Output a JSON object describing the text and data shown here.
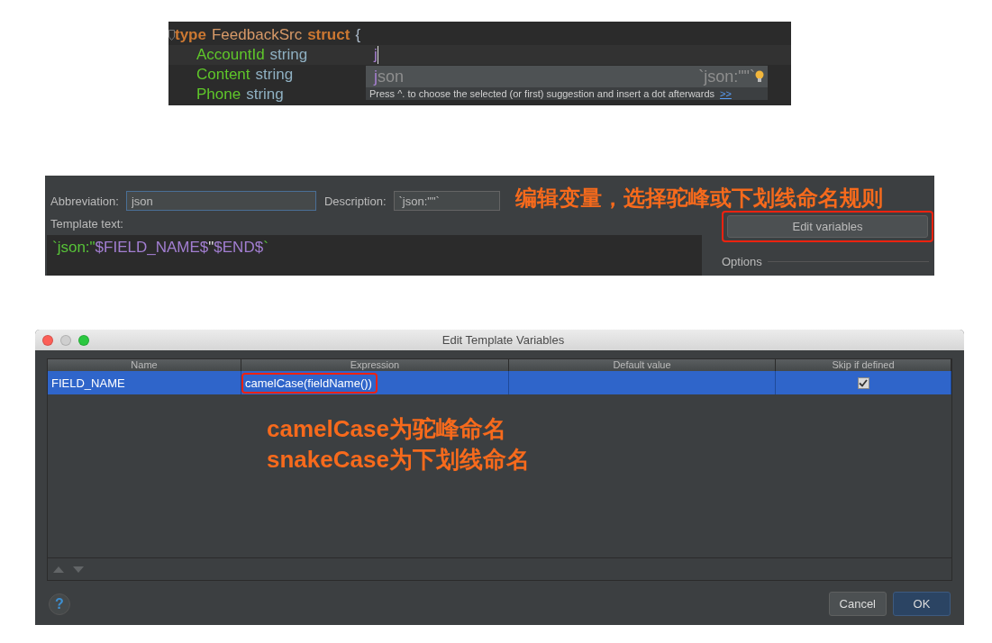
{
  "code_editor": {
    "lines": [
      {
        "highlighted": false,
        "fold": true,
        "tokens": [
          {
            "text": "type",
            "kind": "keyword"
          },
          {
            "text": "FeedbackSrc",
            "kind": "typename"
          },
          {
            "text": "struct",
            "kind": "keyword"
          },
          {
            "text": "{",
            "kind": "plain"
          }
        ]
      },
      {
        "highlighted": true,
        "fold": false,
        "tokens": [
          {
            "text": "AccountId",
            "kind": "field"
          },
          {
            "text": "string",
            "kind": "type"
          }
        ],
        "tail": [
          {
            "text": "j",
            "kind": "typed"
          }
        ]
      },
      {
        "highlighted": false,
        "fold": false,
        "tokens": [
          {
            "text": "Content",
            "kind": "field"
          },
          {
            "text": "string",
            "kind": "type"
          }
        ]
      },
      {
        "highlighted": false,
        "fold": false,
        "tokens": [
          {
            "text": "Phone",
            "kind": "field"
          },
          {
            "text": "string",
            "kind": "type"
          }
        ]
      }
    ],
    "completion_popup": {
      "items": [
        {
          "match": "j",
          "rest": "son",
          "detail": "`json:\"\"`",
          "selected": true
        }
      ],
      "hint": "Press ^. to choose the selected (or first) suggestion and insert a dot afterwards",
      "hint_link": ">>"
    }
  },
  "live_template": {
    "abbreviation_label": "Abbreviation:",
    "abbreviation": "json",
    "description_label": "Description:",
    "description": "`json:\"\"`",
    "template_label": "Template text:",
    "template": [
      {
        "text": "`json:\"",
        "kind": "string"
      },
      {
        "text": "$FIELD_NAME$",
        "kind": "variable"
      },
      {
        "text": "\"",
        "kind": "plain"
      },
      {
        "text": "$END$",
        "kind": "variable"
      },
      {
        "text": "`",
        "kind": "string"
      }
    ],
    "edit_button": "Edit variables",
    "options_label": "Options",
    "annotation": "编辑变量，选择驼峰或下划线命名规则"
  },
  "dialog": {
    "title": "Edit Template Variables",
    "columns": [
      "Name",
      "Expression",
      "Default value",
      "Skip if defined"
    ],
    "rows": [
      {
        "name": "FIELD_NAME",
        "expression": "camelCase(fieldName())",
        "skip_if_defined": true,
        "selected": true
      }
    ],
    "annotation_lines": [
      "camelCase为驼峰命名",
      "snakeCase为下划线命名"
    ],
    "help": "?",
    "buttons": [
      {
        "label": "Cancel",
        "default": false
      },
      {
        "label": "OK",
        "default": true
      }
    ]
  }
}
